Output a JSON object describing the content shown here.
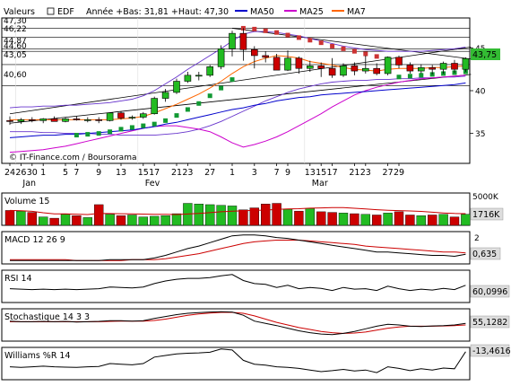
{
  "header": {
    "label": "Valeurs",
    "stock": "EDF",
    "range_text": "Année +Bas: 31,81 +Haut: 47,30",
    "legend": [
      {
        "name": "MA50",
        "color": "#0000cc"
      },
      {
        "name": "MA25",
        "color": "#cc00cc"
      },
      {
        "name": "MA7",
        "color": "#ff6600"
      }
    ]
  },
  "copyright": "© IT-Finance.com / Boursorama",
  "colors": {
    "up": "#22bb22",
    "down": "#cc0000",
    "sar_down": "#cc3333",
    "sar_up": "#119933",
    "price_label_bg": "#33bb33"
  },
  "chart_data": [
    {
      "type": "line",
      "title": "EDF",
      "y_ticks": [
        35,
        40,
        45
      ],
      "ylim": [
        31.5,
        48.5
      ],
      "left_levels": [
        "47,30",
        "46,22",
        "44,87",
        "44,60",
        "43,05",
        "40,60"
      ],
      "left_level_values": [
        47.3,
        46.22,
        44.87,
        44.6,
        43.05,
        40.6
      ],
      "last_value_label": "43,75",
      "last_value": 43.75,
      "x_tick_labels": [
        "24",
        "26",
        "30",
        "1",
        "5",
        "7",
        "9",
        "13",
        "15",
        "17",
        "21",
        "23",
        "27",
        "1",
        "3",
        "7",
        "9",
        "13",
        "15",
        "17",
        "21",
        "23",
        "27",
        "29"
      ],
      "x_tick_index": [
        0,
        1,
        2,
        3,
        5,
        6,
        8,
        10,
        12,
        13,
        15,
        16,
        18,
        20,
        22,
        24,
        25,
        27,
        28,
        29,
        31,
        32,
        34,
        35
      ],
      "months": [
        {
          "label": "Jan",
          "index": 1
        },
        {
          "label": "Fev",
          "index": 12
        },
        {
          "label": "Mar",
          "index": 27
        }
      ],
      "candles": [
        [
          36.5,
          37.0,
          36.0,
          36.4
        ],
        [
          36.4,
          36.8,
          36.1,
          36.6
        ],
        [
          36.6,
          36.9,
          36.3,
          36.5
        ],
        [
          36.5,
          36.8,
          36.2,
          36.7
        ],
        [
          36.7,
          37.0,
          36.4,
          36.4
        ],
        [
          36.4,
          36.9,
          36.3,
          36.7
        ],
        [
          36.7,
          37.0,
          36.5,
          36.6
        ],
        [
          36.6,
          36.9,
          36.3,
          36.6
        ],
        [
          36.6,
          36.9,
          36.2,
          36.5
        ],
        [
          36.5,
          37.0,
          36.4,
          37.4
        ],
        [
          37.4,
          37.6,
          36.6,
          36.8
        ],
        [
          36.8,
          37.1,
          36.6,
          36.9
        ],
        [
          36.9,
          37.5,
          36.7,
          37.3
        ],
        [
          37.3,
          39.3,
          37.2,
          39.1
        ],
        [
          39.1,
          40.2,
          38.7,
          39.8
        ],
        [
          39.8,
          41.4,
          39.6,
          41.1
        ],
        [
          41.1,
          42.2,
          40.9,
          41.8
        ],
        [
          41.8,
          42.2,
          41.2,
          41.8
        ],
        [
          41.8,
          43.0,
          41.6,
          42.8
        ],
        [
          42.8,
          45.3,
          42.5,
          44.9
        ],
        [
          44.9,
          47.0,
          44.0,
          46.7
        ],
        [
          46.7,
          47.3,
          43.5,
          44.8
        ],
        [
          44.8,
          45.2,
          42.6,
          44.1
        ],
        [
          44.1,
          44.6,
          43.3,
          43.9
        ],
        [
          43.9,
          44.3,
          42.6,
          42.4
        ],
        [
          42.4,
          44.7,
          42.3,
          43.8
        ],
        [
          43.8,
          44.0,
          42.0,
          42.6
        ],
        [
          42.6,
          43.5,
          42.2,
          42.9
        ],
        [
          42.9,
          43.3,
          41.6,
          42.6
        ],
        [
          42.6,
          43.8,
          41.5,
          41.8
        ],
        [
          41.8,
          43.2,
          41.6,
          42.9
        ],
        [
          42.9,
          43.3,
          41.8,
          42.3
        ],
        [
          42.3,
          44.1,
          42.0,
          42.6
        ],
        [
          42.6,
          43.2,
          41.8,
          42.0
        ],
        [
          42.0,
          44.0,
          41.8,
          43.9
        ],
        [
          43.9,
          44.1,
          42.6,
          43.0
        ],
        [
          43.0,
          43.3,
          42.0,
          42.3
        ],
        [
          42.3,
          43.1,
          42.0,
          42.7
        ],
        [
          42.7,
          43.0,
          41.9,
          42.5
        ],
        [
          42.5,
          43.4,
          42.0,
          43.2
        ],
        [
          43.2,
          43.6,
          42.1,
          42.5
        ],
        [
          42.5,
          43.9,
          42.2,
          43.75
        ]
      ],
      "sar": [
        null,
        null,
        null,
        null,
        null,
        null,
        34.8,
        34.9,
        35.0,
        35.2,
        35.5,
        35.7,
        35.9,
        36.1,
        36.5,
        37.1,
        37.8,
        38.5,
        39.4,
        40.3,
        41.3,
        47.3,
        47.2,
        47.0,
        46.8,
        46.5,
        46.2,
        45.9,
        45.6,
        45.2,
        44.9,
        44.6,
        44.3,
        44.0,
        43.7,
        41.6,
        41.7,
        41.8,
        41.9,
        42.0,
        42.1,
        42.2
      ],
      "ma50": [
        34.5,
        34.6,
        34.7,
        34.8,
        34.8,
        34.9,
        34.9,
        35.0,
        35.1,
        35.2,
        35.3,
        35.4,
        35.6,
        35.8,
        36.1,
        36.3,
        36.6,
        36.9,
        37.2,
        37.5,
        37.8,
        38.0,
        38.3,
        38.5,
        38.8,
        39.0,
        39.2,
        39.3,
        39.5,
        39.6,
        39.7,
        39.8,
        39.9,
        40.0,
        40.1,
        40.2,
        40.3,
        40.4,
        40.5,
        40.6,
        40.7,
        40.9
      ],
      "ma25": [
        32.8,
        32.9,
        33.0,
        33.1,
        33.3,
        33.5,
        33.8,
        34.1,
        34.4,
        34.7,
        35.0,
        35.3,
        35.6,
        35.8,
        35.9,
        35.9,
        35.7,
        35.5,
        35.2,
        34.6,
        33.9,
        33.4,
        33.7,
        34.1,
        34.6,
        35.2,
        35.9,
        36.6,
        37.3,
        38.1,
        38.8,
        39.5,
        40.0,
        40.4,
        40.7,
        41.0,
        41.2,
        41.4,
        41.5,
        41.6,
        41.7,
        41.8
      ],
      "ma7": [
        36.6,
        36.6,
        36.6,
        36.6,
        36.6,
        36.6,
        36.6,
        36.6,
        36.6,
        36.6,
        36.7,
        36.8,
        37.0,
        37.4,
        37.9,
        38.4,
        39.0,
        39.6,
        40.3,
        41.1,
        42.0,
        42.8,
        43.4,
        43.8,
        44.1,
        44.0,
        43.8,
        43.4,
        43.2,
        43.0,
        42.7,
        42.5,
        42.4,
        42.3,
        42.5,
        42.6,
        42.6,
        42.6,
        42.7,
        42.7,
        42.8,
        42.9
      ],
      "bollinger_upper": [
        38.0,
        38.1,
        38.1,
        38.2,
        38.2,
        38.3,
        38.3,
        38.4,
        38.5,
        38.6,
        38.8,
        39.0,
        39.4,
        40.0,
        40.8,
        41.6,
        42.5,
        43.3,
        44.1,
        44.9,
        45.8,
        46.6,
        46.9,
        46.9,
        46.8,
        46.6,
        46.4,
        46.1,
        45.8,
        45.5,
        45.2,
        45.0,
        44.8,
        44.7,
        44.6,
        44.6,
        44.6,
        44.6,
        44.7,
        44.8,
        44.9,
        45.1
      ],
      "bollinger_lower": [
        35.2,
        35.2,
        35.2,
        35.1,
        35.1,
        35.0,
        35.0,
        35.0,
        34.9,
        34.9,
        34.8,
        34.8,
        34.8,
        34.8,
        34.9,
        35.0,
        35.2,
        35.5,
        35.9,
        36.4,
        37.0,
        37.6,
        38.2,
        38.8,
        39.3,
        39.8,
        40.2,
        40.5,
        40.8,
        41.0,
        41.1,
        41.2,
        41.2,
        41.3,
        41.3,
        41.4,
        41.4,
        41.5,
        41.5,
        41.6,
        41.6,
        41.7
      ],
      "trend_lines": [
        {
          "from": [
            0,
            37.3
          ],
          "to": [
            41,
            45.1
          ]
        },
        {
          "from": [
            20,
            47.3
          ],
          "to": [
            41,
            43.7
          ]
        },
        {
          "from": [
            0,
            36.2
          ],
          "to": [
            41,
            41.9
          ]
        }
      ]
    },
    {
      "type": "bar",
      "title": "Volume 15",
      "y_top_label": "5000K",
      "last_value_label": "1716K",
      "ylim": [
        0,
        5000
      ],
      "volumes": [
        2300,
        2200,
        2000,
        1300,
        1100,
        1700,
        1500,
        1200,
        3200,
        1700,
        1500,
        1600,
        1300,
        1400,
        1500,
        1800,
        3400,
        3300,
        3200,
        3100,
        3000,
        2400,
        2700,
        3300,
        3400,
        2500,
        2200,
        2600,
        2100,
        2000,
        1900,
        1800,
        1700,
        1600,
        1900,
        2100,
        1600,
        1500,
        1600,
        1700,
        1300,
        1716
      ]
    },
    {
      "type": "line",
      "title": "MACD 12 26 9",
      "y_ticks": [
        2
      ],
      "last_value_label": "0,635",
      "ylim": [
        -0.5,
        3.3
      ],
      "macd": [
        -0.1,
        -0.1,
        -0.1,
        -0.1,
        -0.1,
        -0.1,
        -0.1,
        -0.1,
        -0.1,
        0.0,
        0.0,
        0.0,
        0.0,
        0.2,
        0.5,
        0.9,
        1.3,
        1.6,
        2.0,
        2.4,
        2.8,
        2.9,
        2.9,
        2.8,
        2.6,
        2.5,
        2.3,
        2.1,
        1.9,
        1.7,
        1.5,
        1.3,
        1.1,
        0.9,
        0.9,
        0.8,
        0.7,
        0.6,
        0.5,
        0.5,
        0.4,
        0.635
      ],
      "signal": [
        0.0,
        0.0,
        0.0,
        0.0,
        0.0,
        0.0,
        -0.1,
        -0.1,
        -0.1,
        -0.1,
        -0.1,
        0.0,
        0.0,
        0.0,
        0.1,
        0.3,
        0.5,
        0.7,
        1.0,
        1.3,
        1.6,
        1.9,
        2.1,
        2.2,
        2.3,
        2.3,
        2.3,
        2.2,
        2.1,
        2.0,
        1.9,
        1.8,
        1.6,
        1.5,
        1.4,
        1.3,
        1.2,
        1.1,
        1.0,
        0.9,
        0.9,
        0.8
      ]
    },
    {
      "type": "line",
      "title": "RSI 14",
      "last_value_label": "60,0996",
      "ylim": [
        20,
        95
      ],
      "rsi": [
        52,
        51,
        50,
        51,
        50,
        51,
        50,
        51,
        52,
        56,
        55,
        54,
        56,
        64,
        70,
        74,
        76,
        76,
        78,
        82,
        85,
        71,
        64,
        62,
        55,
        60,
        52,
        55,
        53,
        48,
        55,
        51,
        52,
        48,
        58,
        52,
        48,
        51,
        49,
        53,
        50,
        60.1
      ]
    },
    {
      "type": "line",
      "title": "Stochastique 14 3 3",
      "last_value_label": "55,1282",
      "ylim": [
        0,
        100
      ],
      "k": [
        62,
        60,
        60,
        61,
        60,
        61,
        59,
        60,
        61,
        63,
        63,
        62,
        63,
        70,
        76,
        82,
        86,
        88,
        90,
        91,
        90,
        80,
        62,
        55,
        48,
        40,
        32,
        26,
        22,
        20,
        24,
        30,
        38,
        46,
        52,
        50,
        46,
        45,
        47,
        48,
        50,
        55.1
      ],
      "d": [
        60,
        60,
        60,
        60,
        60,
        60,
        60,
        60,
        60,
        61,
        62,
        62,
        62,
        64,
        68,
        74,
        80,
        84,
        87,
        89,
        89,
        86,
        78,
        68,
        58,
        50,
        42,
        36,
        30,
        26,
        24,
        25,
        28,
        34,
        40,
        44,
        46,
        46,
        46,
        47,
        48,
        50
      ]
    },
    {
      "type": "line",
      "title": "Williams %R 14",
      "last_value_label": "-13,4616",
      "ylim": [
        -100,
        0
      ],
      "wr": [
        -60,
        -62,
        -60,
        -58,
        -60,
        -61,
        -62,
        -60,
        -59,
        -50,
        -52,
        -54,
        -50,
        -30,
        -25,
        -20,
        -18,
        -17,
        -15,
        -5,
        -8,
        -40,
        -52,
        -55,
        -60,
        -62,
        -65,
        -70,
        -75,
        -72,
        -68,
        -73,
        -70,
        -78,
        -60,
        -65,
        -72,
        -66,
        -70,
        -64,
        -66,
        -13.46
      ]
    }
  ]
}
